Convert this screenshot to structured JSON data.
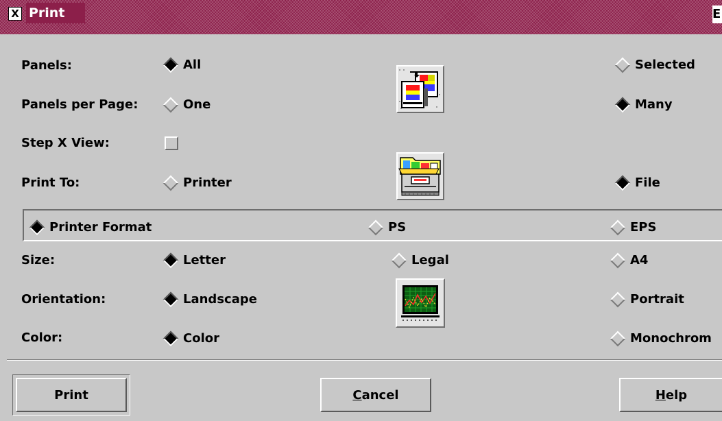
{
  "window": {
    "title": "Print",
    "menu_glyph": "X",
    "titlebar_right_glyph": "E"
  },
  "panels": {
    "label": "Panels:",
    "options": [
      "All",
      "Selected"
    ],
    "selected": "All"
  },
  "panels_per_page": {
    "label": "Panels per Page:",
    "options": [
      "One",
      "Many"
    ],
    "selected": "Many"
  },
  "step_x_view": {
    "label": "Step X View:",
    "checked": false
  },
  "print_to": {
    "label": "Print To:",
    "options": [
      "Printer",
      "File"
    ],
    "selected": "File"
  },
  "format": {
    "options": [
      "Printer Format",
      "PS",
      "EPS"
    ],
    "selected": "Printer Format"
  },
  "size": {
    "label": "Size:",
    "options": [
      "Letter",
      "Legal",
      "A4"
    ],
    "selected": "Letter"
  },
  "orientation": {
    "label": "Orientation:",
    "options": [
      "Landscape",
      "Portrait"
    ],
    "selected": "Landscape"
  },
  "color": {
    "label": "Color:",
    "options": [
      "Color",
      "Monochrom"
    ],
    "selected": "Color"
  },
  "icons": {
    "panels": "panels-icon",
    "print_to": "printer-file-icon",
    "page_format": "chart-preview-icon"
  },
  "buttons": {
    "print": "Print",
    "cancel_mnemonic": "C",
    "cancel_rest": "ancel",
    "help_mnemonic": "H",
    "help_rest": "elp"
  },
  "colors": {
    "titlebar": "#8c1f4a",
    "background": "#c8c8c8"
  }
}
